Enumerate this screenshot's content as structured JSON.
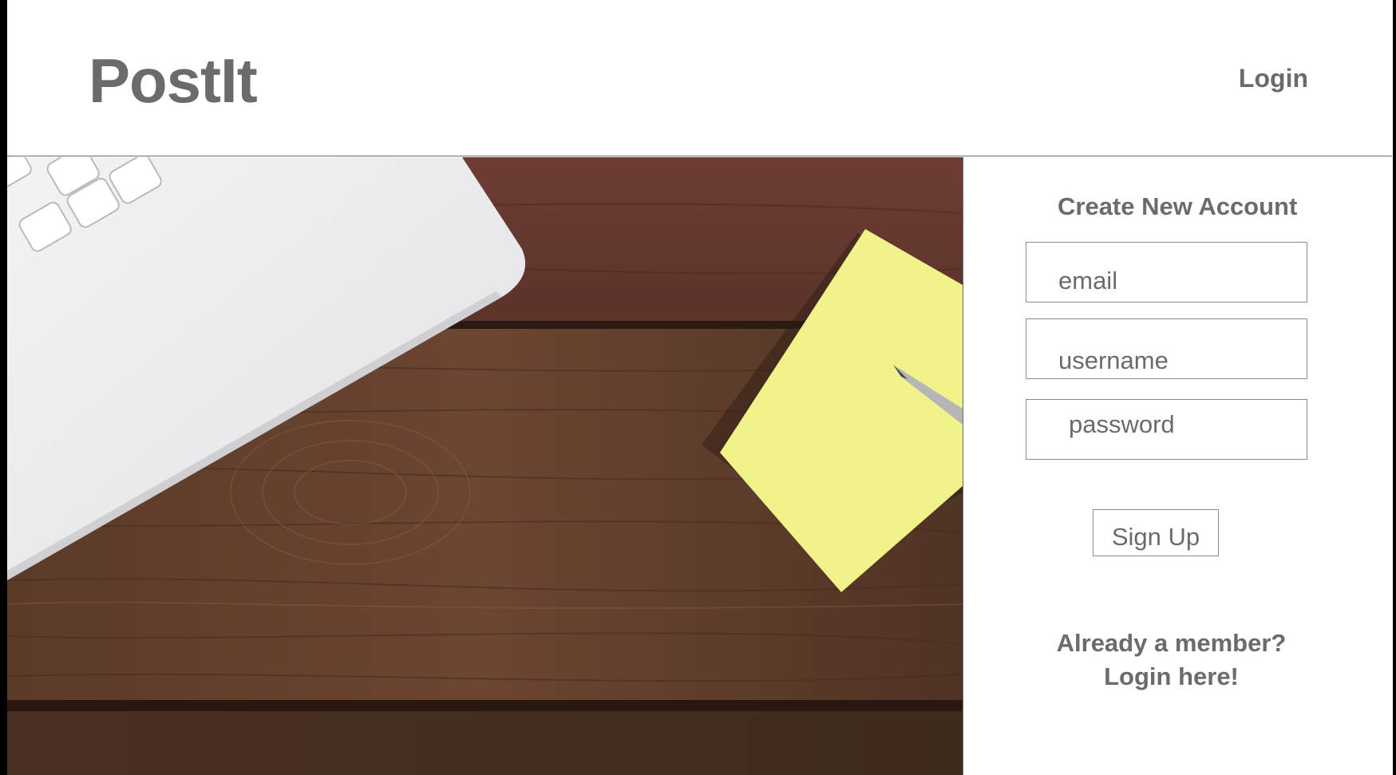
{
  "header": {
    "brand": "PostIt",
    "login_link": "Login"
  },
  "signup_form": {
    "title": "Create New Account",
    "email_placeholder": "email",
    "username_placeholder": "username",
    "password_placeholder": "password",
    "submit_label": "Sign Up",
    "login_prompt_line1": "Already a member?",
    "login_prompt_line2": "Login here!"
  },
  "colors": {
    "text": "#6b6b6b",
    "background": "#ffffff",
    "wood": "#5a3a2a",
    "sticky_note": "#f2f28a"
  }
}
